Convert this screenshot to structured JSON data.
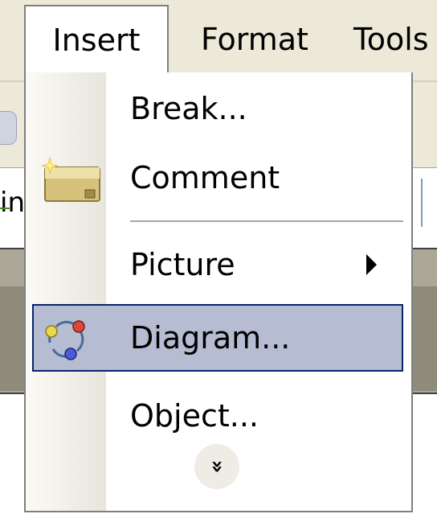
{
  "menubar": {
    "items": [
      {
        "label": "Insert"
      },
      {
        "label": "Format"
      },
      {
        "label": "Tools"
      }
    ]
  },
  "background": {
    "field_text": "in"
  },
  "insert_menu": {
    "items": [
      {
        "label": "Break...",
        "icon": null
      },
      {
        "label": "Comment",
        "icon": "comment-icon"
      },
      {
        "label": "Picture",
        "icon": null,
        "submenu": true
      },
      {
        "label": "Diagram...",
        "icon": "diagram-icon",
        "selected": true
      },
      {
        "label": "Object...",
        "icon": null
      }
    ],
    "expand_glyph": "»",
    "colors": {
      "highlight_fill": "#b6bdd2",
      "highlight_border": "#0a246a"
    }
  }
}
